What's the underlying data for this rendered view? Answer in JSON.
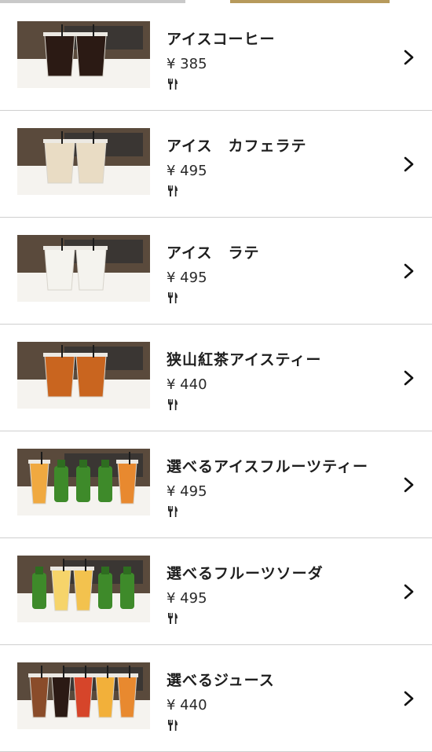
{
  "colors": {
    "accent": "#b79a5c",
    "divider": "#cfcfcf",
    "text": "#1e1e1e"
  },
  "icons": {
    "row_icon": "cutlery-icon",
    "nav_icon": "chevron-right-icon"
  },
  "menu": {
    "items": [
      {
        "name": "アイスコーヒー",
        "price": "¥ 385",
        "drink_colors": [
          "#2b1a14",
          "#2b1a14"
        ]
      },
      {
        "name": "アイス　カフェラテ",
        "price": "¥ 495",
        "drink_colors": [
          "#e9dcc4",
          "#e9dcc4"
        ]
      },
      {
        "name": "アイス　ラテ",
        "price": "¥ 495",
        "drink_colors": [
          "#f4f3ee",
          "#f4f3ee"
        ]
      },
      {
        "name": "狭山紅茶アイスティー",
        "price": "¥ 440",
        "drink_colors": [
          "#c9651f",
          "#c9651f"
        ]
      },
      {
        "name": "選べるアイスフルーツティー",
        "price": "¥ 495",
        "drink_colors": [
          "#f0a940",
          "#3e8a2a",
          "#3e8a2a",
          "#3e8a2a",
          "#e8892f"
        ]
      },
      {
        "name": "選べるフルーツソーダ",
        "price": "¥ 495",
        "drink_colors": [
          "#3e8a2a",
          "#f6d46a",
          "#f3c24e",
          "#3e8a2a",
          "#3e8a2a"
        ]
      },
      {
        "name": "選べるジュース",
        "price": "¥ 440",
        "drink_colors": [
          "#8a4c2a",
          "#2b1a14",
          "#d6452a",
          "#f2b03a",
          "#e8892f"
        ]
      }
    ]
  }
}
